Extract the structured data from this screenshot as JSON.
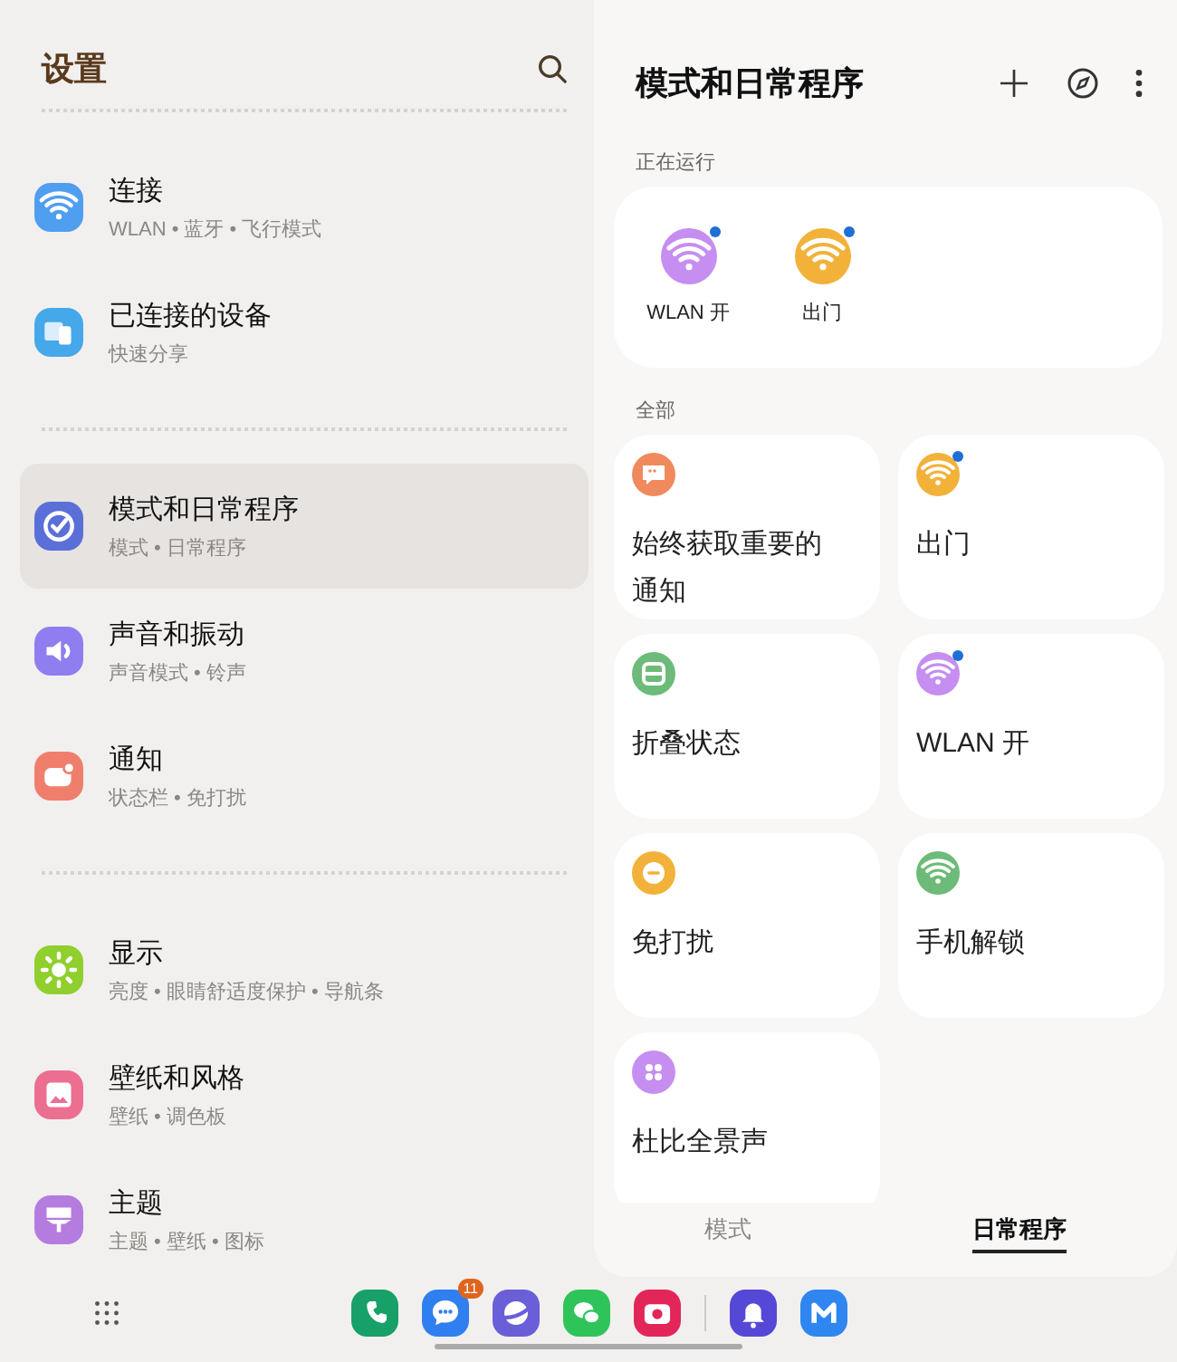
{
  "settings": {
    "title": "设置",
    "groups": [
      {
        "items": [
          {
            "title": "连接",
            "subtitle": "WLAN • 蓝牙 • 飞行模式",
            "kind": "wifi",
            "color": "#4f9ef0",
            "selected": false
          },
          {
            "title": "已连接的设备",
            "subtitle": "快速分享",
            "kind": "devices",
            "color": "#45a8ea",
            "selected": false
          }
        ]
      },
      {
        "items": [
          {
            "title": "模式和日常程序",
            "subtitle": "模式 • 日常程序",
            "kind": "check",
            "color": "#5a6fd8",
            "selected": true
          },
          {
            "title": "声音和振动",
            "subtitle": "声音模式 • 铃声",
            "kind": "sound",
            "color": "#8e7ef0",
            "selected": false
          },
          {
            "title": "通知",
            "subtitle": "状态栏 • 免打扰",
            "kind": "notification",
            "color": "#ef7f6c",
            "selected": false
          }
        ]
      },
      {
        "items": [
          {
            "title": "显示",
            "subtitle": "亮度 • 眼睛舒适度保护 • 导航条",
            "kind": "sun",
            "color": "#8fcf2e",
            "selected": false
          },
          {
            "title": "壁纸和风格",
            "subtitle": "壁纸 • 调色板",
            "kind": "wallpaper",
            "color": "#ec6f92",
            "selected": false
          },
          {
            "title": "主题",
            "subtitle": "主题 • 壁纸 • 图标",
            "kind": "theme",
            "color": "#b57ce0",
            "selected": false
          }
        ]
      }
    ]
  },
  "routines": {
    "title": "模式和日常程序",
    "running_label": "正在运行",
    "running": [
      {
        "label": "WLAN 开",
        "kind": "wifi",
        "color": "#c58ef0",
        "active": true
      },
      {
        "label": "出门",
        "kind": "wifi",
        "color": "#f2b23a",
        "active": true
      }
    ],
    "all_label": "全部",
    "all": [
      {
        "label": "始终获取重要的通知",
        "kind": "chat",
        "color": "#f08a5d",
        "active": false
      },
      {
        "label": "出门",
        "kind": "wifi",
        "color": "#f2b23a",
        "active": true
      },
      {
        "label": "折叠状态",
        "kind": "fold",
        "color": "#6dbb78",
        "active": false
      },
      {
        "label": "WLAN 开",
        "kind": "wifi",
        "color": "#c58ef0",
        "active": true
      },
      {
        "label": "免打扰",
        "kind": "dnd",
        "color": "#f2b23a",
        "active": false
      },
      {
        "label": "手机解锁",
        "kind": "wifi",
        "color": "#6dbb78",
        "active": false
      },
      {
        "label": "杜比全景声",
        "kind": "grid",
        "color": "#c58ef0",
        "active": false
      }
    ],
    "tabs": [
      {
        "label": "模式",
        "selected": false
      },
      {
        "label": "日常程序",
        "selected": true
      }
    ]
  },
  "dock": {
    "apps": [
      {
        "kind": "phone",
        "color": "#17a068"
      },
      {
        "kind": "messages",
        "color": "#2f7ff0",
        "badge": "11"
      },
      {
        "kind": "internet",
        "color": "#6a5fd8"
      },
      {
        "kind": "wechat",
        "color": "#2fc45a"
      },
      {
        "kind": "camera",
        "color": "#e3265a"
      },
      {
        "kind": "bell",
        "color": "#5648d6",
        "separator_before": true
      },
      {
        "kind": "m",
        "color": "#2f86f0"
      }
    ]
  }
}
